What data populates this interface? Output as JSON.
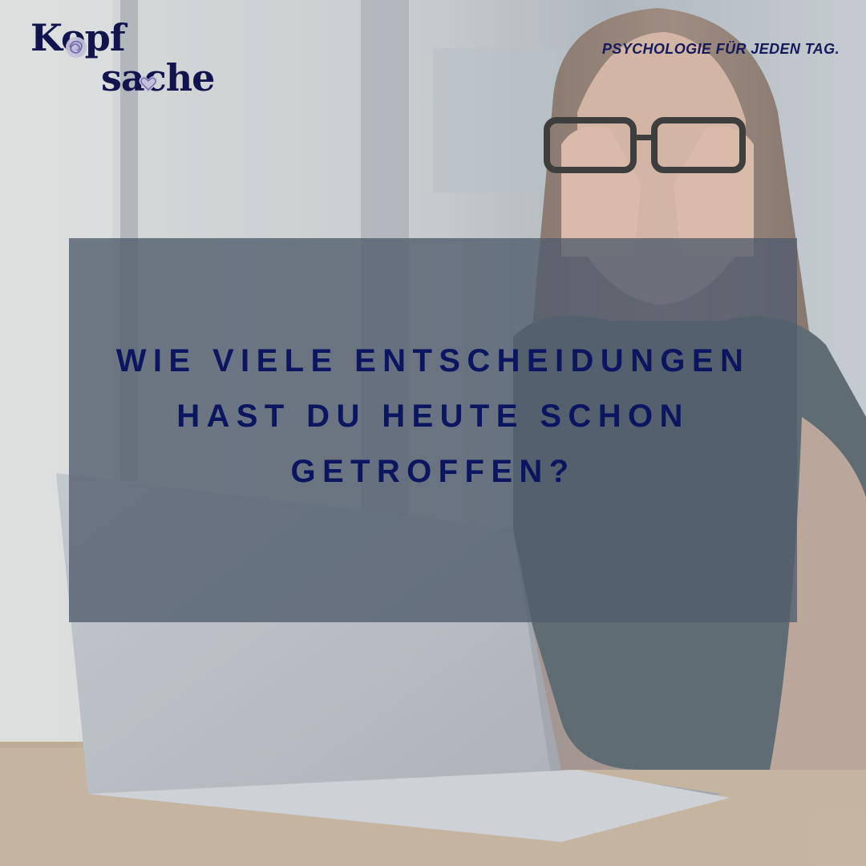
{
  "brand": {
    "logo_line_1": "Kopf",
    "logo_line_2": "sache",
    "tagline": "PSYCHOLOGIE FÜR JEDEN TAG."
  },
  "headline": {
    "lines": [
      "WIE VIELE ENTSCHEIDUNGEN",
      "HAST DU HEUTE SCHON",
      "GETROFFEN?"
    ]
  },
  "colors": {
    "brand_navy": "#12144e",
    "headline": "#0c1660",
    "panel": "#525e6e",
    "logo_accent": "#8b82c0"
  },
  "photo": {
    "subject": "photo-woman-covering-eyes-at-laptop"
  }
}
